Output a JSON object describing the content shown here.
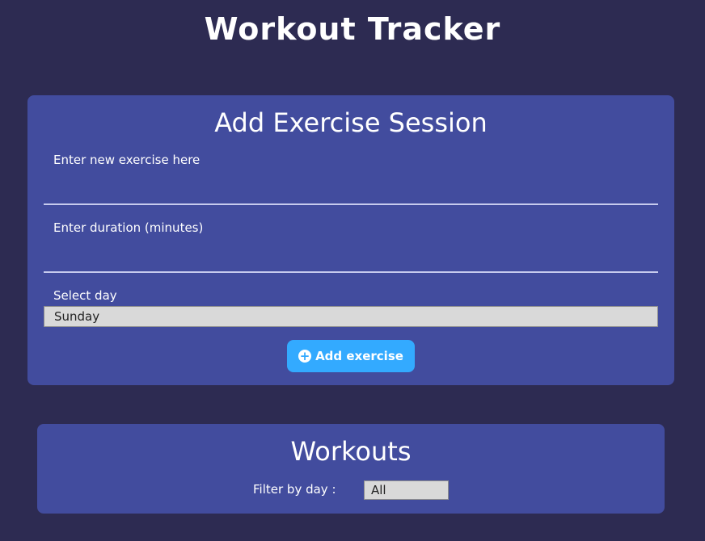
{
  "app": {
    "title": "Workout Tracker"
  },
  "add_session": {
    "title": "Add Exercise Session",
    "exercise_label": "Enter new exercise here",
    "exercise_value": "",
    "duration_label": "Enter duration (minutes)",
    "duration_value": "",
    "day_label": "Select day",
    "day_selected": "Sunday",
    "add_button_label": "Add exercise",
    "add_button_icon": "plus-circle-icon"
  },
  "workouts": {
    "title": "Workouts",
    "filter_label": "Filter by day :",
    "filter_selected": "All"
  },
  "colors": {
    "background": "#2d2b52",
    "panel": "#424c9e",
    "button": "#33aaff",
    "text": "#ffffff"
  }
}
